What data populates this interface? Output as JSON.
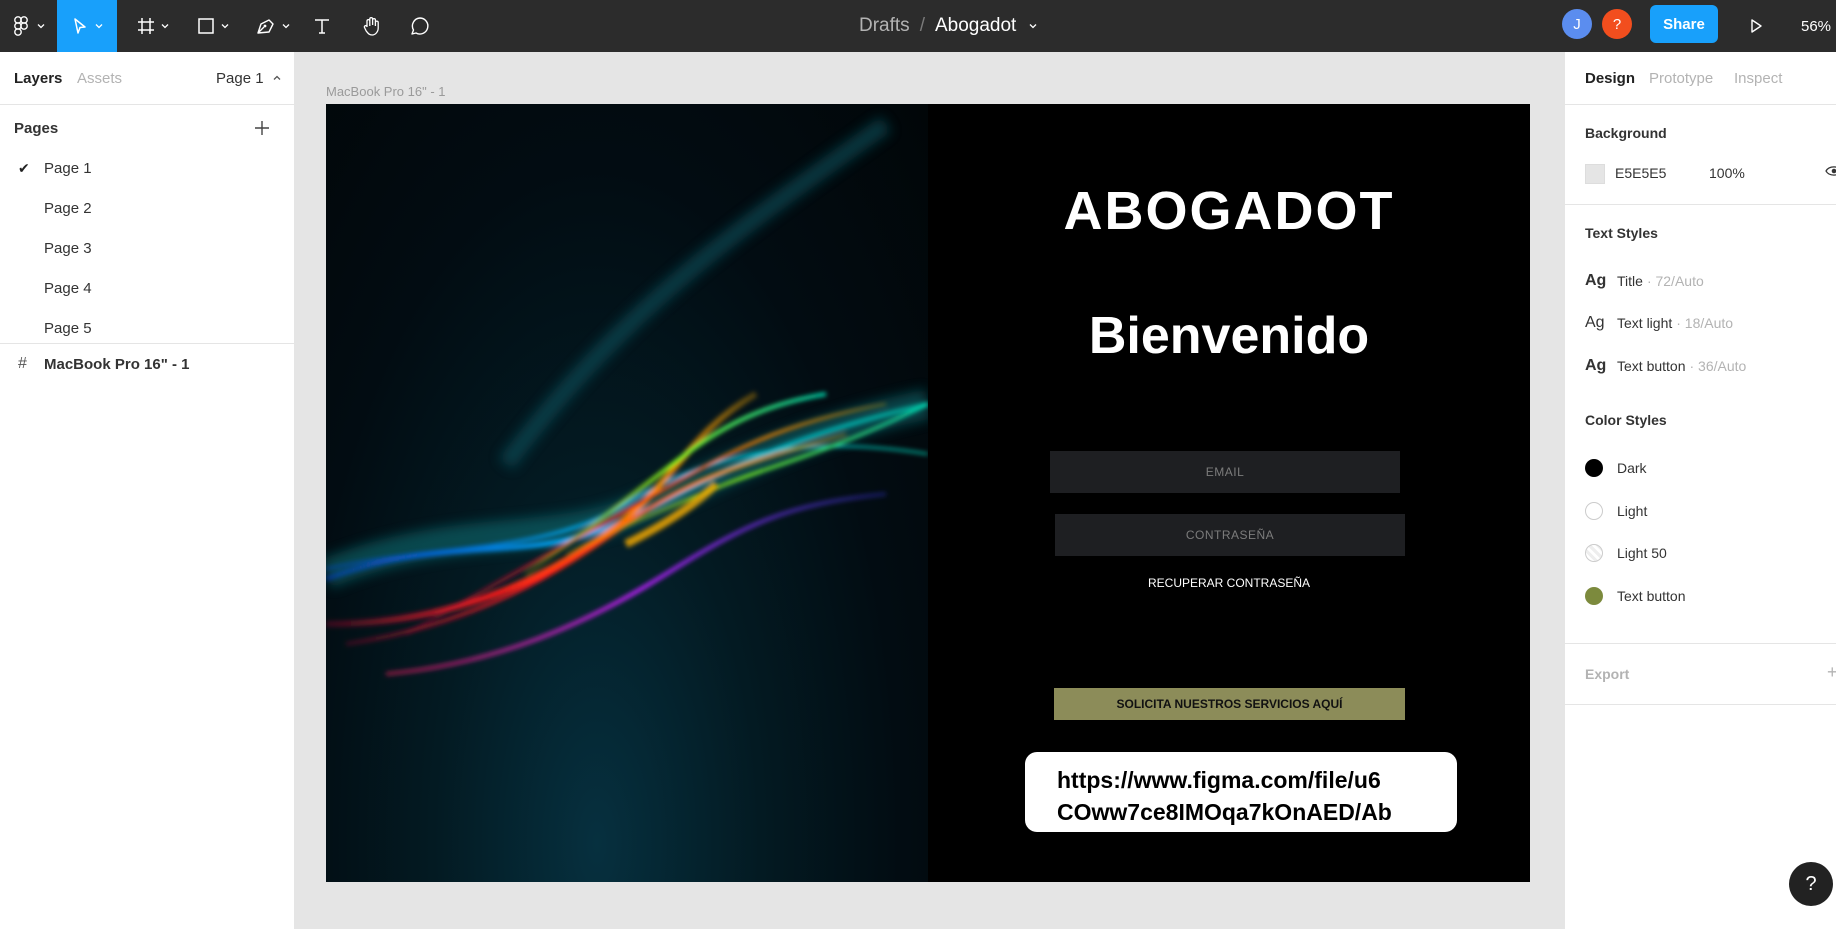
{
  "topbar": {
    "breadcrumb_root": "Drafts",
    "breadcrumb_sep": "/",
    "file_name": "Abogadot",
    "avatar1_letter": "J",
    "avatar2_letter": "?",
    "avatar1_color": "#5b8def",
    "avatar2_color": "#f24e1e",
    "share_label": "Share",
    "zoom": "56%"
  },
  "left_panel": {
    "tab_layers": "Layers",
    "tab_assets": "Assets",
    "page_selector": "Page 1",
    "pages_header": "Pages",
    "pages": [
      {
        "label": "Page 1",
        "active": true
      },
      {
        "label": "Page 2",
        "active": false
      },
      {
        "label": "Page 3",
        "active": false
      },
      {
        "label": "Page 4",
        "active": false
      },
      {
        "label": "Page 5",
        "active": false
      }
    ],
    "layer_name": "MacBook Pro 16\" - 1"
  },
  "canvas": {
    "frame_label": "MacBook Pro 16\" - 1",
    "design": {
      "title": "ABOGADOT",
      "welcome": "Bienvenido",
      "email_placeholder": "EMAIL",
      "password_placeholder": "CONTRASEÑA",
      "recover_label": "RECUPERAR CONTRASEÑA",
      "cta_label": "SOLICITA NUESTROS SERVICIOS AQUÍ",
      "cta_color": "#8c8c59",
      "url_line1": "https://www.figma.com/file/u6",
      "url_line2": "COww7ce8IMOqa7kOnAED/Ab"
    }
  },
  "right_panel": {
    "tab_design": "Design",
    "tab_prototype": "Prototype",
    "tab_inspect": "Inspect",
    "background_header": "Background",
    "background_hex": "E5E5E5",
    "background_opacity": "100%",
    "text_styles_header": "Text Styles",
    "text_styles": [
      {
        "name": "Title",
        "meta": "· 72/Auto"
      },
      {
        "name": "Text light",
        "meta": "· 18/Auto"
      },
      {
        "name": "Text button",
        "meta": "· 36/Auto"
      }
    ],
    "color_styles_header": "Color Styles",
    "color_styles": [
      {
        "name": "Dark",
        "color": "#000000"
      },
      {
        "name": "Light",
        "color": "#ffffff"
      },
      {
        "name": "Light 50",
        "color": "#ffffff80"
      },
      {
        "name": "Text button",
        "color": "#8c8c59"
      }
    ],
    "export_label": "Export"
  },
  "help_label": "?"
}
